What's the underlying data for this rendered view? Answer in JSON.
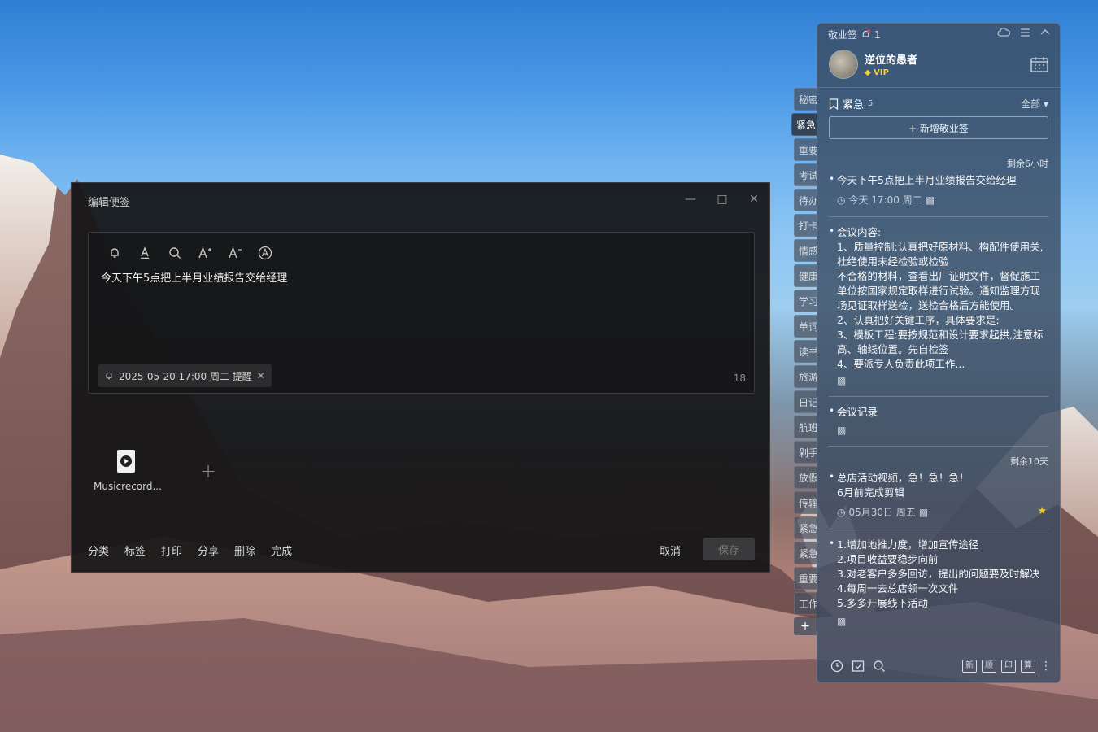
{
  "editor": {
    "title": "编辑便签",
    "content": "今天下午5点把上半月业绩报告交给经理",
    "reminder": "2025-05-20 17:00 周二 提醒",
    "char_count": "18",
    "attachment_name": "Musicrecord...",
    "actions": [
      "分类",
      "标签",
      "打印",
      "分享",
      "删除",
      "完成"
    ],
    "cancel": "取消",
    "save": "保存"
  },
  "tabs": [
    "秘密",
    "紧急",
    "重要",
    "考试",
    "待办",
    "打卡",
    "情感",
    "健康",
    "学习",
    "单词",
    "读书",
    "旅游",
    "日记",
    "航班",
    "剁手",
    "放假",
    "传输",
    "紧急",
    "紧急",
    "重要",
    "工作"
  ],
  "panel": {
    "app_name": "敬业签",
    "notify_count": "1",
    "user_name": "逆位的愚者",
    "vip": "VIP",
    "category": "紧急",
    "category_count": "5",
    "filter": "全部",
    "add_button": "+ 新增敬业签",
    "notes": [
      {
        "remaining": "剩余6小时",
        "text": "今天下午5点把上半月业绩报告交给经理",
        "meta": "今天 17:00 周二",
        "starred": false
      },
      {
        "remaining": "",
        "text": "会议内容:\n1、质量控制:认真把好原材料、构配件使用关,杜绝使用未经检验或检验\n不合格的材料，查看出厂证明文件，督促施工单位按国家规定取样进行试验。通知监理方现场见证取样送检，送检合格后方能使用。\n2、认真把好关键工序，具体要求是:\n3、模板工程:要按规范和设计要求起拱,注意标高、轴线位置。先自检签\n4、要派专人负责此项工作...",
        "meta": "",
        "starred": false
      },
      {
        "remaining": "",
        "text": "会议记录",
        "meta": "",
        "starred": false
      },
      {
        "remaining": "剩余10天",
        "text": "总店活动视频，急！急！急！\n6月前完成剪辑",
        "meta": "05月30日 周五",
        "starred": true
      },
      {
        "remaining": "",
        "text": "1.增加地推力度，增加宣传途径\n2.项目收益要稳步向前\n3.对老客户多多回访，提出的问题要及时解决\n4.每周一去总店领一次文件\n5.多多开展线下活动",
        "meta": "",
        "starred": false
      }
    ],
    "bottom_icons": [
      "clock-icon",
      "checklist-icon",
      "search-icon"
    ],
    "bottom_right": [
      "新",
      "顺",
      "印",
      "算"
    ]
  }
}
